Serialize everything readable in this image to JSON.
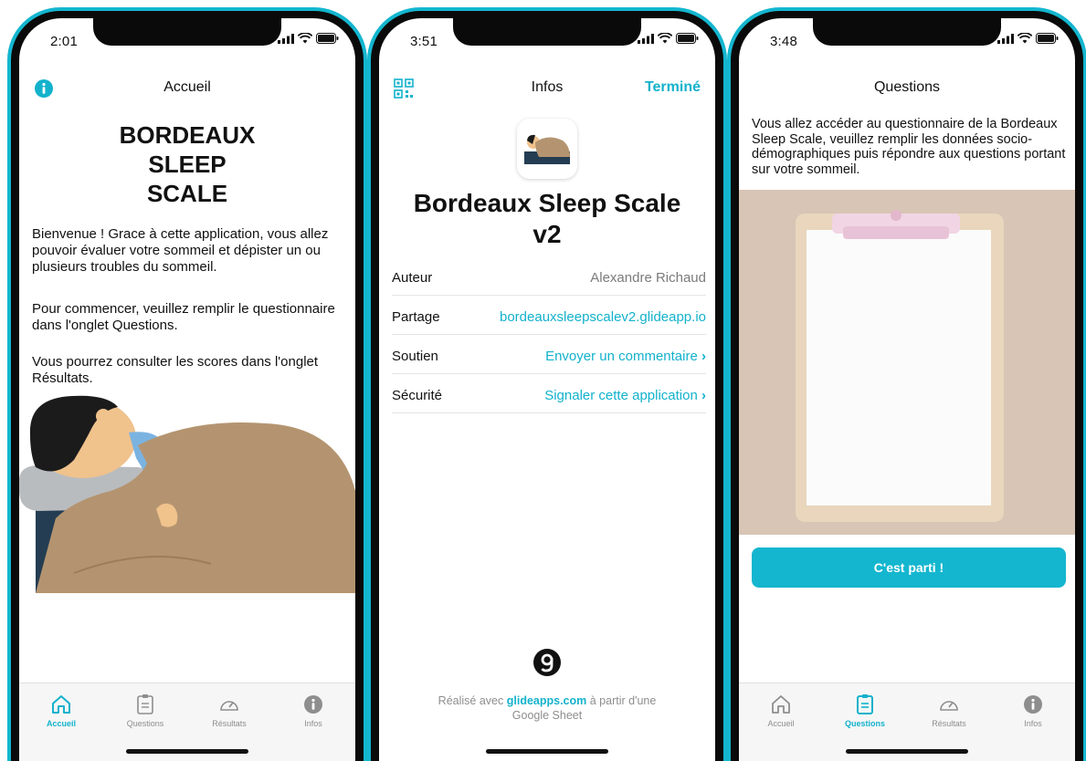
{
  "status_bar": {
    "times": [
      "2:01",
      "3:51",
      "3:48"
    ]
  },
  "accent_color": "#13b2cc",
  "screens": [
    {
      "nav": {
        "title": "Accueil",
        "left_icon": "info-icon"
      },
      "title_lines": [
        "BORDEAUX",
        "SLEEP",
        "SCALE"
      ],
      "paragraphs": [
        "Bienvenue ! Grace à cette application, vous allez pouvoir évaluer votre sommeil et dépister un ou plusieurs troubles du sommeil.",
        "Pour commencer, veuillez remplir le questionnaire dans l'onglet Questions.",
        "Vous pourrez consulter les scores dans l'onglet Résultats."
      ],
      "illustration": "sleeping-person-illustration",
      "active_tab": "Accueil"
    },
    {
      "nav": {
        "title": "Infos",
        "left_icon": "qr-code-icon",
        "right_label": "Terminé"
      },
      "app_name": "Bordeaux Sleep Scale v2",
      "rows": [
        {
          "key": "Auteur",
          "value": "Alexandre Richaud"
        },
        {
          "key": "Partage",
          "value": "bordeauxsleepscalev2.glideapp.io"
        },
        {
          "key": "Soutien",
          "value": "Envoyer un commentaire",
          "chevron": "›"
        },
        {
          "key": "Sécurité",
          "value": "Signaler cette application",
          "chevron": "›"
        }
      ],
      "footer": {
        "prefix": "Réalisé avec",
        "link": "glideapps.com",
        "suffix": "à partir d'une",
        "line2": "Google Sheet"
      }
    },
    {
      "nav": {
        "title": "Questions"
      },
      "intro": "Vous allez accéder au questionnaire de la Bordeaux Sleep Scale, veuillez remplir les données socio-démographiques puis répondre aux questions portant sur votre sommeil.",
      "image": "clipboard-photo",
      "cta_label": "C'est parti !",
      "active_tab": "Questions"
    }
  ],
  "tabs": [
    {
      "label": "Accueil",
      "icon": "home-icon"
    },
    {
      "label": "Questions",
      "icon": "clipboard-icon"
    },
    {
      "label": "Résultats",
      "icon": "gauge-icon"
    },
    {
      "label": "Infos",
      "icon": "info-icon"
    }
  ]
}
